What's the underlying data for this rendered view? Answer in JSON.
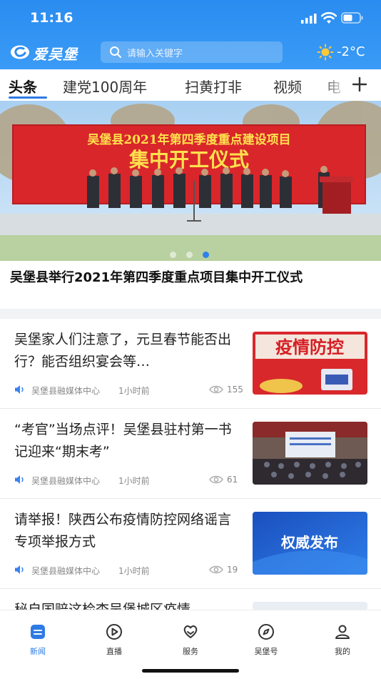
{
  "status_bar": {
    "time": "11:16"
  },
  "header": {
    "logo_text": "爱吴堡",
    "search_placeholder": "请输入关键字",
    "weather_temp": "-2°C"
  },
  "tabs": [
    {
      "label": "头条",
      "active": true
    },
    {
      "label": "建党100周年",
      "active": false
    },
    {
      "label": "扫黄打非",
      "active": false
    },
    {
      "label": "视频",
      "active": false
    },
    {
      "label": "电",
      "active": false
    }
  ],
  "banner": {
    "sign_line1": "吴堡县2021年第四季度重点建设项目",
    "sign_line2": "集中开工仪式",
    "headline": "吴堡县举行2021年第四季度重点项目集中开工仪式",
    "slides_total": 3,
    "active_slide": 3
  },
  "news": [
    {
      "title": "吴堡家人们注意了，元旦春节能否出行？能否组织宴会等…",
      "source": "吴堡县融媒体中心",
      "time": "1小时前",
      "views": "155",
      "thumb_text": "疫情防控"
    },
    {
      "title": "“考官”当场点评！吴堡县驻村第一书记迎来“期末考”",
      "source": "吴堡县融媒体中心",
      "time": "1小时前",
      "views": "61",
      "thumb_text": ""
    },
    {
      "title": "请举报！陕西公布疫情防控网络谣言专项举报方式",
      "source": "吴堡县融媒体中心",
      "time": "1小时前",
      "views": "19",
      "thumb_text": "权威发布"
    },
    {
      "title": "秘自国赔这检杳吴堡城区疫情",
      "source": "",
      "time": "",
      "views": "",
      "thumb_text": ""
    }
  ],
  "bottom_nav": [
    {
      "label": "新闻",
      "icon": "news-icon",
      "active": true
    },
    {
      "label": "直播",
      "icon": "live-play-icon",
      "active": false
    },
    {
      "label": "服务",
      "icon": "service-heart-icon",
      "active": false
    },
    {
      "label": "吴堡号",
      "icon": "compass-icon",
      "active": false
    },
    {
      "label": "我的",
      "icon": "profile-icon",
      "active": false
    }
  ],
  "colors": {
    "header_blue": "#2a8cf0",
    "accent_blue": "#2e7be4",
    "banner_red": "#d9262b",
    "sign_yellow": "#ffe14d"
  }
}
